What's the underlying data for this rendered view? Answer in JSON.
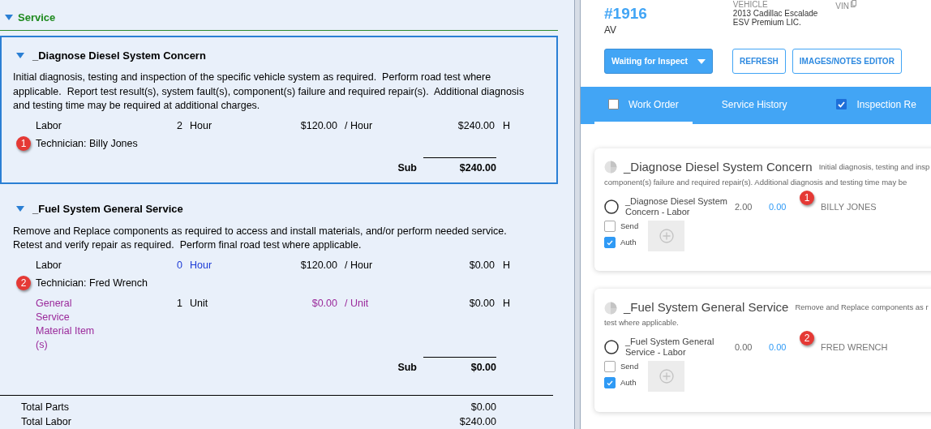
{
  "left": {
    "section": {
      "title": "Service",
      "expanded": true
    },
    "jobs": [
      {
        "title": "_Diagnose Diesel System Concern",
        "expanded": true,
        "selected": true,
        "description": "Initial diagnosis, testing and inspection of the specific vehicle system as required.  Perform road test where applicable.  Report test result(s), system fault(s), component(s) failure and required repair(s).  Additional diagnosis and testing time may be required at additional charges.",
        "lines": [
          {
            "kind": "labor",
            "description": "Labor",
            "qty": "2",
            "unit": "Hour",
            "qty_changed": false,
            "price": "$120.00",
            "per": "/ Hour",
            "total": "$240.00",
            "flag": "H",
            "technician": "Technician: Billy Jones",
            "badge": "1"
          }
        ],
        "sub_label": "Sub",
        "sub_total": "$240.00"
      },
      {
        "title": "_Fuel System General Service",
        "expanded": true,
        "selected": false,
        "description": "Remove and Replace components as required to access and install materials, and/or perform needed service.  Retest and verify repair as required.  Perform final road test where applicable.",
        "lines": [
          {
            "kind": "labor",
            "description": "Labor",
            "qty": "0",
            "unit": "Hour",
            "qty_changed": true,
            "price": "$120.00",
            "per": "/ Hour",
            "total": "$0.00",
            "flag": "H",
            "technician": "Technician: Fred Wrench",
            "badge": "2"
          },
          {
            "kind": "material",
            "description": "General Service Material Item (s)",
            "qty": "1",
            "unit": "Unit",
            "qty_changed": false,
            "price": "$0.00",
            "per": "/ Unit",
            "total": "$0.00",
            "flag": "H"
          }
        ],
        "sub_label": "Sub",
        "sub_total": "$0.00"
      }
    ],
    "totals": [
      {
        "label": "Total Parts",
        "value": "$0.00"
      },
      {
        "label": "Total Labor",
        "value": "$240.00"
      }
    ]
  },
  "right": {
    "order_number": "#1916",
    "customer": "AV",
    "vehicle_label": "VEHICLE",
    "vehicle_lines": [
      "2013 Cadillac Escalade",
      "ESV Premium LIC."
    ],
    "vin_label": "VIN",
    "status_button": "Waiting for Inspect",
    "buttons": [
      "REFRESH",
      "IMAGES/NOTES EDITOR"
    ],
    "tabs": [
      {
        "kind": "check",
        "label": "Work Order",
        "checked": false,
        "selected": true
      },
      {
        "kind": "plain",
        "label": "Service History",
        "selected": false
      },
      {
        "kind": "check",
        "label": "Inspection Re",
        "checked": true,
        "selected": false
      }
    ],
    "cards": [
      {
        "title": "_Diagnose Diesel System Concern",
        "description_lines": [
          "Initial diagnosis, testing and insp",
          "component(s) failure and required repair(s). Additional diagnosis and testing time may be"
        ],
        "item": {
          "selected": false,
          "name": "_Diagnose Diesel System Concern - Labor",
          "hours": "2.00",
          "price": "0.00",
          "technician": "BILLY JONES",
          "badge": "1"
        },
        "send": false,
        "auth": true,
        "send_label": "Send",
        "auth_label": "Auth"
      },
      {
        "title": "_Fuel System General Service",
        "description_lines": [
          "Remove and Replace components as r",
          "test where applicable."
        ],
        "item": {
          "selected": false,
          "name": "_Fuel System General Service - Labor",
          "hours": "0.00",
          "price": "0.00",
          "technician": "FRED WRENCH",
          "badge": "2"
        },
        "send": false,
        "auth": true,
        "send_label": "Send",
        "auth_label": "Auth"
      }
    ]
  }
}
